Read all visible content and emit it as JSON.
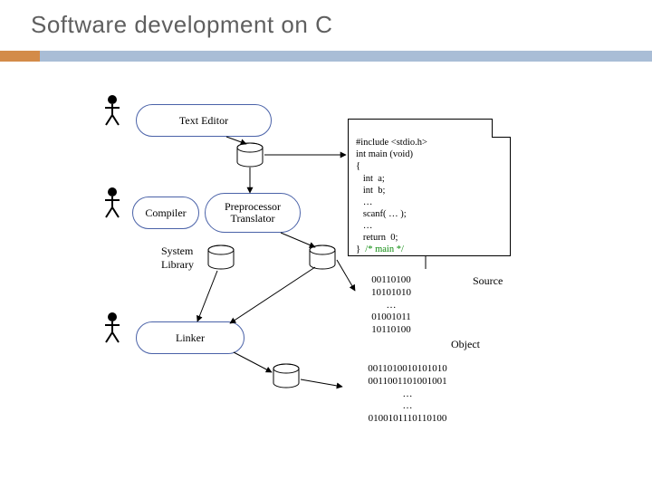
{
  "title": "Software development on C",
  "stages": {
    "editor": "Text Editor",
    "compiler": "Compiler",
    "preproc": "Preprocessor\nTranslator",
    "linker": "Linker"
  },
  "labels": {
    "syslib": "System\nLibrary",
    "source": "Source",
    "object": "Object"
  },
  "source_code": {
    "l1": "#include <stdio.h>",
    "l2": "int main (void)",
    "l3": "{",
    "l4": "   int  a;",
    "l5": "   int  b;",
    "l6": "   …",
    "l7": "   scanf( … );",
    "l8": "   …",
    "l9": "   return  0;",
    "l10a": "}  ",
    "l10b": "/* main */"
  },
  "object_bits": "00110100\n10101010\n…\n01001011\n10110100",
  "exe_bits": "0011010010101010\n0011001101001001\n…\n…\n0100101110110100"
}
